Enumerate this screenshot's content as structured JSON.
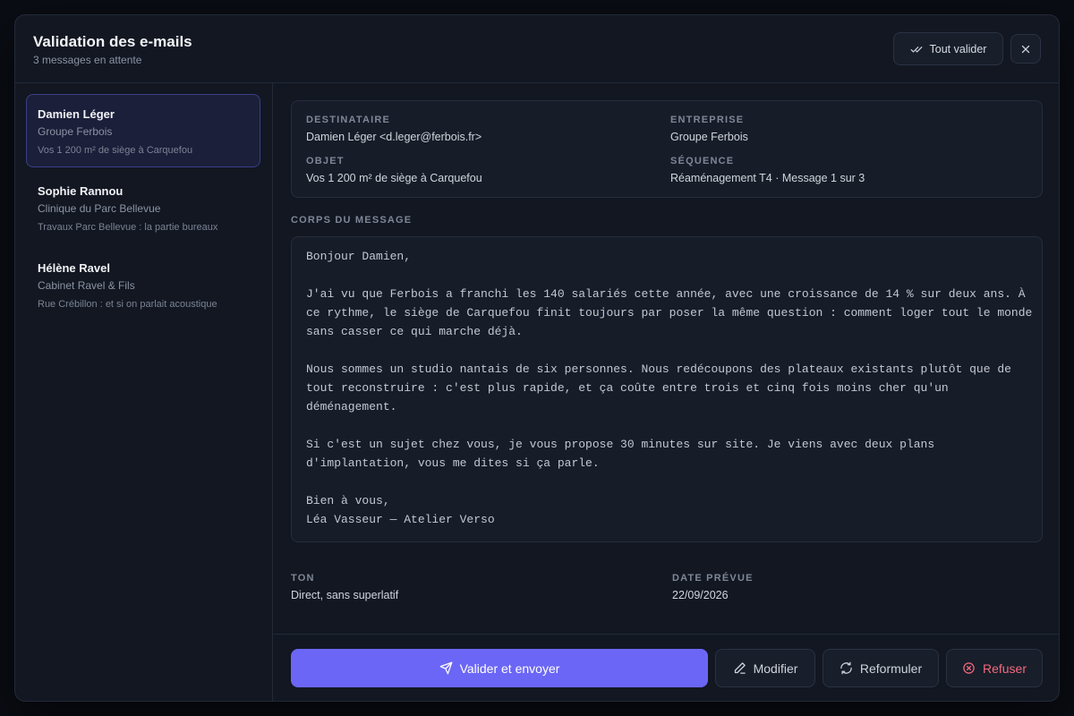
{
  "header": {
    "title": "Validation des e-mails",
    "subtitle": "3 messages en attente",
    "validate_all_label": "Tout valider",
    "validate_all_icon": "double-check-icon",
    "close_icon": "close-icon"
  },
  "sidebar": {
    "items": [
      {
        "name": "Damien Léger",
        "company": "Groupe Ferbois",
        "subject": "Vos 1 200 m² de siège à Carquefou",
        "active": true
      },
      {
        "name": "Sophie Rannou",
        "company": "Clinique du Parc Bellevue",
        "subject": "Travaux Parc Bellevue : la partie bureaux",
        "active": false
      },
      {
        "name": "Hélène Ravel",
        "company": "Cabinet Ravel & Fils",
        "subject": "Rue Crébillon : et si on parlait acoustique",
        "active": false
      }
    ]
  },
  "detail": {
    "recipient_label": "DESTINATAIRE",
    "recipient_value": "Damien Léger <d.leger@ferbois.fr>",
    "company_label": "ENTREPRISE",
    "company_value": "Groupe Ferbois",
    "subject_label": "OBJET",
    "subject_value": "Vos 1 200 m² de siège à Carquefou",
    "sequence_label": "SÉQUENCE",
    "sequence_value": "Réaménagement T4 · Message 1 sur 3",
    "body_label": "CORPS DU MESSAGE",
    "body_lines": [
      "Bonjour Damien,",
      "",
      "J'ai vu que Ferbois a franchi les 140 salariés cette année, avec une croissance de 14 % sur deux ans. À",
      "ce rythme, le siège de Carquefou finit toujours par poser la même question : comment loger tout le monde",
      "sans casser ce qui marche déjà.",
      "",
      "Nous sommes un studio nantais de six personnes. Nous redécoupons des plateaux existants plutôt que de",
      "tout reconstruire : c'est plus rapide, et ça coûte entre trois et cinq fois moins cher qu'un",
      "déménagement.",
      "",
      "Si c'est un sujet chez vous, je vous propose 30 minutes sur site. Je viens avec deux plans",
      "d'implantation, vous me dites si ça parle.",
      "",
      "Bien à vous,",
      "Léa Vasseur — Atelier Verso"
    ],
    "tone_label": "TON",
    "tone_value": "Direct, sans superlatif",
    "date_label": "DATE PRÉVUE",
    "date_value": "22/09/2026"
  },
  "actions": {
    "validate_send_label": "Valider et envoyer",
    "edit_label": "Modifier",
    "rephrase_label": "Reformuler",
    "reject_label": "Refuser"
  },
  "colors": {
    "accent": "#6b66f5",
    "danger": "#f26a7e",
    "background": "#121722"
  }
}
